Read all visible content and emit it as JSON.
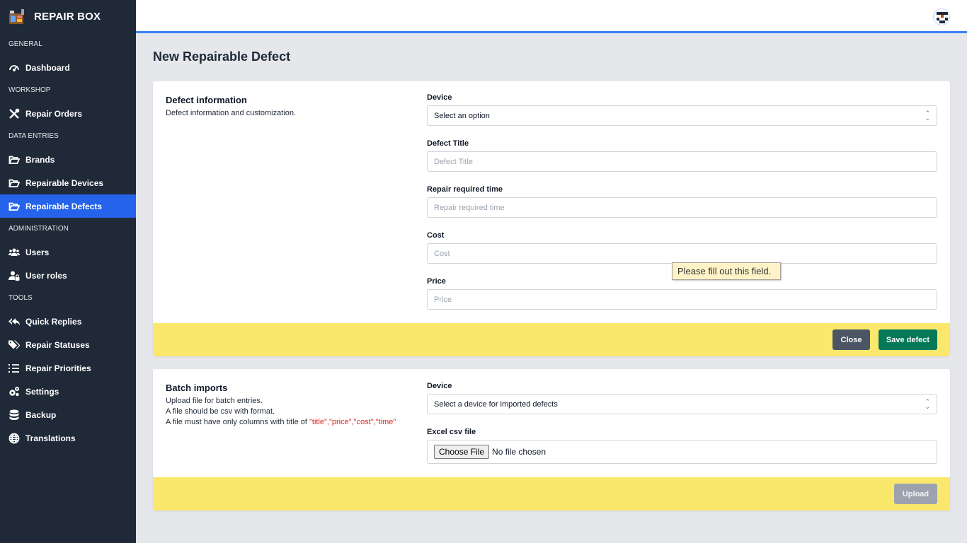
{
  "app": {
    "name": "REPAIR BOX"
  },
  "sidebar": {
    "sections": {
      "general": "GENERAL",
      "workshop": "WORKSHOP",
      "data_entries": "DATA ENTRIES",
      "administration": "ADMINISTRATION",
      "tools": "TOOLS"
    },
    "items": {
      "dashboard": {
        "label": "Dashboard",
        "icon": "gauge-icon"
      },
      "repair_orders": {
        "label": "Repair Orders",
        "icon": "tools-icon"
      },
      "brands": {
        "label": "Brands",
        "icon": "folder-open-icon"
      },
      "repairable_devices": {
        "label": "Repairable Devices",
        "icon": "folder-open-icon"
      },
      "repairable_defects": {
        "label": "Repairable Defects",
        "icon": "folder-open-icon",
        "active": true
      },
      "users": {
        "label": "Users",
        "icon": "users-icon"
      },
      "user_roles": {
        "label": "User roles",
        "icon": "user-lock-icon"
      },
      "quick_replies": {
        "label": "Quick Replies",
        "icon": "reply-all-icon"
      },
      "repair_statuses": {
        "label": "Repair Statuses",
        "icon": "tags-icon"
      },
      "repair_priorities": {
        "label": "Repair Priorities",
        "icon": "list-icon"
      },
      "settings": {
        "label": "Settings",
        "icon": "gears-icon"
      },
      "backup": {
        "label": "Backup",
        "icon": "database-icon"
      },
      "translations": {
        "label": "Translations",
        "icon": "globe-icon"
      }
    }
  },
  "page": {
    "title": "New Repairable Defect"
  },
  "defect_card": {
    "title": "Defect information",
    "description": "Defect information and customization.",
    "device": {
      "label": "Device",
      "value": "Select an option"
    },
    "defect_title": {
      "label": "Defect Title",
      "placeholder": "Defect Title"
    },
    "repair_time": {
      "label": "Repair required time",
      "placeholder": "Repair required time"
    },
    "cost": {
      "label": "Cost",
      "placeholder": "Cost"
    },
    "price": {
      "label": "Price",
      "placeholder": "Price"
    },
    "close_label": "Close",
    "save_label": "Save defect"
  },
  "tooltip": {
    "text": "Please fill out this field."
  },
  "batch_card": {
    "title": "Batch imports",
    "line1": "Upload file for batch entries.",
    "line2": "A file should be csv with format.",
    "line3_prefix": "A file must have only columns with title of ",
    "line3_columns": "\"title\",\"price\",\"cost\",\"time\"",
    "device": {
      "label": "Device",
      "value": "Select a device for imported defects"
    },
    "file": {
      "label": "Excel csv file",
      "button": "Choose File",
      "status": "No file chosen"
    },
    "upload_label": "Upload"
  },
  "colors": {
    "sidebar_bg": "#1f2937",
    "active_bg": "#2563eb",
    "footer_bg": "#fae86c",
    "save_btn": "#047857",
    "close_btn": "#4b5563",
    "upload_btn_disabled": "#9ca3af"
  }
}
